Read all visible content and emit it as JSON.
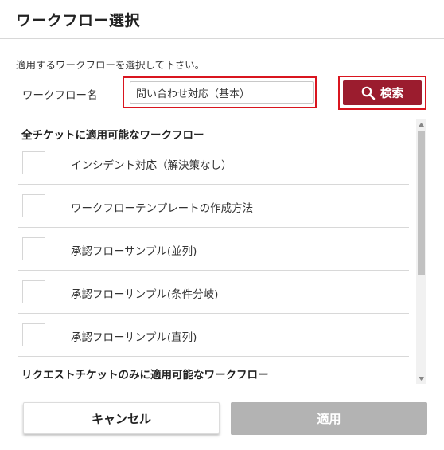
{
  "dialog": {
    "title": "ワークフロー選択",
    "instruction": "適用するワークフローを選択して下さい。"
  },
  "search": {
    "label": "ワークフロー名",
    "value": "問い合わせ対応（基本）",
    "button_label": "検索",
    "button_icon": "search-icon"
  },
  "groups": [
    {
      "header": "全チケットに適用可能なワークフロー",
      "items": [
        {
          "label": "インシデント対応（解決策なし）",
          "checked": false
        },
        {
          "label": "ワークフローテンプレートの作成方法",
          "checked": false
        },
        {
          "label": "承認フローサンプル(並列)",
          "checked": false
        },
        {
          "label": "承認フローサンプル(条件分岐)",
          "checked": false
        },
        {
          "label": "承認フローサンプル(直列)",
          "checked": false
        }
      ]
    },
    {
      "header": "リクエストチケットのみに適用可能なワークフロー",
      "items": []
    }
  ],
  "footer": {
    "cancel_label": "キャンセル",
    "apply_label": "適用"
  },
  "colors": {
    "accent": "#9b1c2e",
    "highlight": "#d9151f",
    "disabled": "#b3b3b3"
  }
}
